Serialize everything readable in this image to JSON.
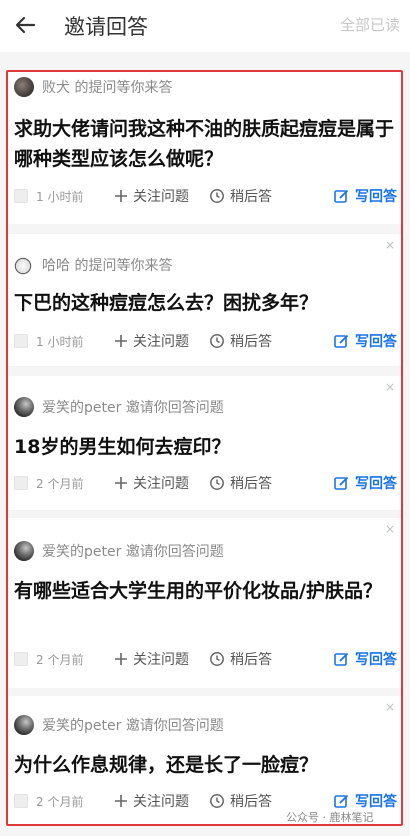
{
  "header": {
    "title": "邀请回答",
    "mark_all_read": "全部已读"
  },
  "labels": {
    "follow": "关注问题",
    "later": "稍后答",
    "answer": "写回答",
    "close": "×"
  },
  "cards": [
    {
      "user": "败犬",
      "action": "的提问等你来答",
      "question": "求助大佬请问我这种不油的肤质起痘痘是属于哪种类型应该怎么做呢？",
      "time": "1 小时前"
    },
    {
      "user": "哈哈",
      "action": "的提问等你来答",
      "question": "下巴的这种痘痘怎么去？困扰多年？",
      "time": "1 小时前"
    },
    {
      "user": "爱笑的peter",
      "action": "邀请你回答问题",
      "question": "18岁的男生如何去痘印？",
      "time": "2 个月前"
    },
    {
      "user": "爱笑的peter",
      "action": "邀请你回答问题",
      "question": "有哪些适合大学生用的平价化妆品/护肤品？",
      "time": "2 个月前"
    },
    {
      "user": "爱笑的peter",
      "action": "邀请你回答问题",
      "question": "为什么作息规律，还是长了一脸痘？",
      "time": "2 个月前"
    }
  ],
  "watermark": "公众号 · 鹿林笔记"
}
